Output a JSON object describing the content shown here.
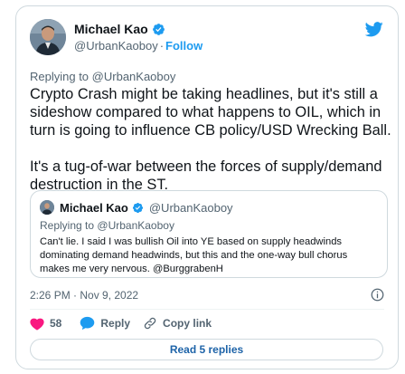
{
  "colors": {
    "brand": "#1d9bf0",
    "like": "#f91880",
    "text": "#0f1419",
    "muted": "#536471",
    "border": "#cfd9de"
  },
  "tweet": {
    "author": {
      "name": "Michael Kao",
      "handle": "@UrbanKaoboy",
      "verified": true
    },
    "follow_label": "Follow",
    "dot": "·",
    "replying_prefix": "Replying to",
    "replying_handle": "@UrbanKaoboy",
    "text": "Crypto Crash might be taking headlines, but it's still a sideshow compared to what happens to OIL, which in turn is going to influence CB policy/USD Wrecking Ball.\n\nIt's a tug-of-war between the forces of supply/demand destruction in the ST.",
    "quote": {
      "name": "Michael Kao",
      "handle": "@UrbanKaoboy",
      "replying_prefix": "Replying to",
      "replying_handle": "@UrbanKaoboy",
      "text": "Can't lie. I said I was bullish Oil into YE based on supply headwinds dominating demand headwinds, but this and the one-way bull chorus makes me very nervous. @BurggrabenH"
    },
    "timestamp": "2:26 PM · Nov 9, 2022",
    "likes": "58",
    "reply_label": "Reply",
    "copy_link_label": "Copy link",
    "read_replies_label": "Read 5 replies"
  },
  "icons": [
    "avatar",
    "verified-badge-icon",
    "twitter-bird-icon",
    "info-icon",
    "heart-icon",
    "reply-icon",
    "link-icon"
  ]
}
